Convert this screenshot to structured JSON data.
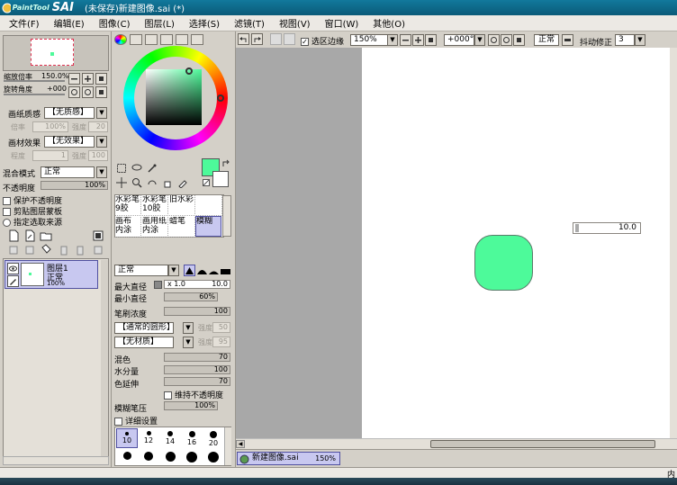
{
  "app": {
    "logo_small": "PaintTool",
    "logo_big": "SAI",
    "window_title": "(未保存)新建图像.sai (*)"
  },
  "menu": [
    "文件(F)",
    "编辑(E)",
    "图像(C)",
    "图层(L)",
    "选择(S)",
    "滤镜(T)",
    "视图(V)",
    "窗口(W)",
    "其他(O)"
  ],
  "navigator": {
    "zoom_label": "缩放倍率",
    "zoom_value": "150.0%",
    "rotate_label": "旋转角度",
    "rotate_value": "+000"
  },
  "paper": {
    "texture_label": "画纸质感",
    "texture_value": "【无质感】",
    "tex_scale_label": "倍率",
    "tex_scale_value": "100%",
    "tex_strength_label": "强度",
    "tex_strength_value": "20",
    "effect_label": "画材效果",
    "effect_value": "【无效果】",
    "eff_degree_label": "程度",
    "eff_degree_value": "1",
    "eff_strength_label": "强度",
    "eff_strength_value": "100"
  },
  "layer_props": {
    "blend_label": "混合模式",
    "blend_value": "正常",
    "opacity_label": "不透明度",
    "opacity_value": "100%",
    "protect_opacity": "保护不透明度",
    "clip_group": "剪贴图层蒙板",
    "selection_source": "指定选取来源"
  },
  "layers": [
    {
      "name": "图层1",
      "mode": "正常",
      "opacity": "100%"
    }
  ],
  "colors": {
    "primary": "#4dfa9a",
    "secondary": "#ffffff",
    "accent": "#c8c8f0",
    "title_bar": "#0a6a8c"
  },
  "brushes": [
    {
      "name": "水彩笔",
      "size": "9胶",
      "active": false
    },
    {
      "name": "水彩笔",
      "size": "10胶",
      "active": false
    },
    {
      "name": "旧水彩",
      "size": "",
      "active": false
    },
    {
      "name": "",
      "size": "",
      "active": false
    },
    {
      "name": "画布",
      "size": "内涂",
      "active": false
    },
    {
      "name": "画用纸",
      "size": "内涂",
      "active": false
    },
    {
      "name": "蜡笔",
      "size": "",
      "active": false
    },
    {
      "name": "模糊",
      "size": "",
      "active": true
    }
  ],
  "brush_settings": {
    "mode_value": "正常",
    "max_size_label": "最大直径",
    "max_size_mult": "x 1.0",
    "max_size_value": "10.0",
    "min_size_label": "最小直径",
    "min_size_value": "60%",
    "density_label": "笔刷浓度",
    "density_value": "100",
    "shape_value": "【通常的圆形】",
    "shape_strength_label": "强度",
    "shape_strength_value": "50",
    "texture_value": "【无材质】",
    "texture_strength_label": "强度",
    "texture_strength_value": "95",
    "blend_label": "混色",
    "blend_value": "70",
    "water_label": "水分量",
    "water_value": "100",
    "persist_label": "色延伸",
    "persist_value": "70",
    "keep_opacity": "维持不透明度",
    "blur_pressure_label": "模糊笔压",
    "blur_pressure_value": "100%",
    "detail_label": "详细设置"
  },
  "brush_sizes": [
    "10",
    "12",
    "14",
    "16",
    "20"
  ],
  "toolbar": {
    "selection_edge": "选区边缘",
    "zoom": "150%",
    "rotate": "+000°",
    "mode": "正常",
    "stabilizer_label": "抖动修正",
    "stabilizer_value": "3"
  },
  "canvas": {
    "float_value": "10.0"
  },
  "doc_tab": {
    "name": "新建图像.sai",
    "zoom": "150%"
  },
  "status": {
    "right_text": "内"
  }
}
